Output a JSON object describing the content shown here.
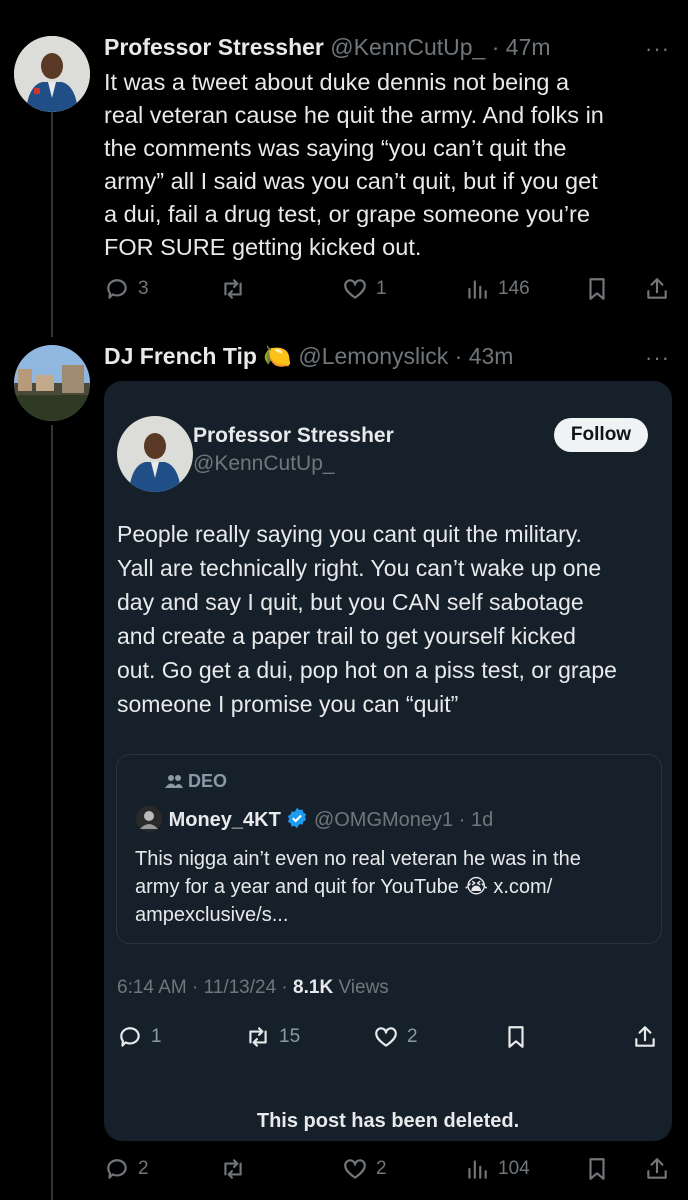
{
  "post1": {
    "display_name": "Professor Stressher",
    "handle": "@KennCutUp_",
    "time": "· 47m",
    "more": "···",
    "text_lines": [
      "It was a tweet about duke dennis not being a",
      "real veteran cause he quit the army. And folks in",
      "the comments was saying “you can’t quit the",
      "army” all I said was you can’t quit, but if you get",
      "a dui, fail a drug test, or grape someone you’re",
      "FOR SURE getting kicked out."
    ],
    "replies": "3",
    "reposts": "",
    "likes": "1",
    "views": "146"
  },
  "post2": {
    "display_name": "DJ French Tip",
    "emoji": "🍋",
    "handle": "@Lemonyslick",
    "time": "· 43m",
    "more": "···",
    "replies": "2",
    "reposts": "",
    "likes": "2",
    "views": "104"
  },
  "quoted": {
    "display_name": "Professor Stressher",
    "handle": "@KennCutUp_",
    "follow_label": "Follow",
    "text_lines": [
      "People really saying you cant quit the military.",
      "Yall are technically right. You can’t wake up one",
      "day and say I quit, but you CAN self sabotage",
      "and create a paper trail to get yourself kicked",
      "out. Go get a dui, pop hot on a piss test, or grape",
      "someone I promise you can “quit”"
    ],
    "timestamp": "6:14 AM · 11/13/24 · ",
    "views_count": "8.1K",
    "views_label": " Views",
    "replies": "1",
    "reposts": "15",
    "likes": "2",
    "deleted_notice": "This post has been deleted."
  },
  "nested": {
    "community": "DEO",
    "display_name": "Money_4KT",
    "handle": "@OMGMoney1",
    "time": "· 1d",
    "text_lines": [
      "This nigga ain’t even no real veteran he was in the",
      "army for a year and quit for YouTube 😭 x.com/",
      "ampexclusive/s..."
    ]
  },
  "colors": {
    "background": "#000000",
    "card": "#16202b",
    "muted": "#71767b",
    "verified": "#1d9bf0"
  }
}
